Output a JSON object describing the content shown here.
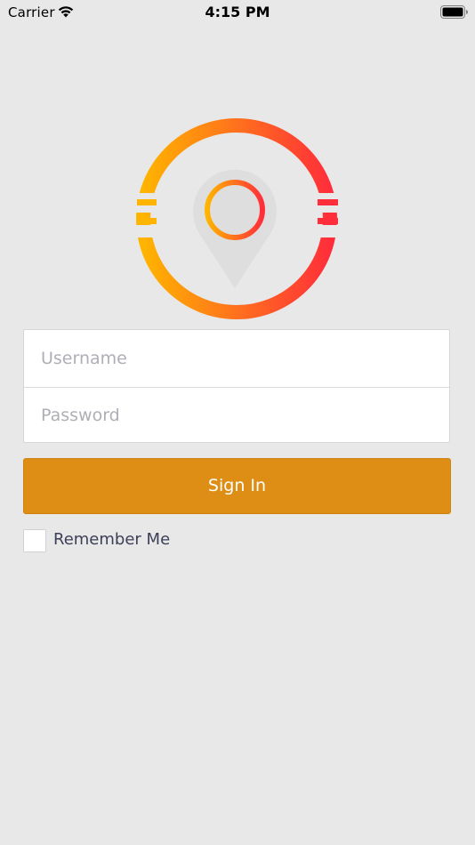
{
  "status_bar": {
    "carrier": "Carrier",
    "time": "4:15 PM",
    "wifi_icon": "wifi-icon",
    "battery_icon": "battery-icon"
  },
  "logo": {
    "icon": "location-pin-ring-logo",
    "gradient_start": "#ffb400",
    "gradient_end": "#ff2e3a",
    "pin_color": "#dedede"
  },
  "login_form": {
    "username_placeholder": "Username",
    "password_placeholder": "Password",
    "username_value": "",
    "password_value": ""
  },
  "sign_in_button": {
    "label": "Sign In",
    "color": "#de8d15"
  },
  "remember_me": {
    "label": "Remember Me",
    "checked": false
  },
  "colors": {
    "background": "#e8e8e8",
    "label_text": "#3c3f58",
    "placeholder_text": "#aeaeb6"
  }
}
